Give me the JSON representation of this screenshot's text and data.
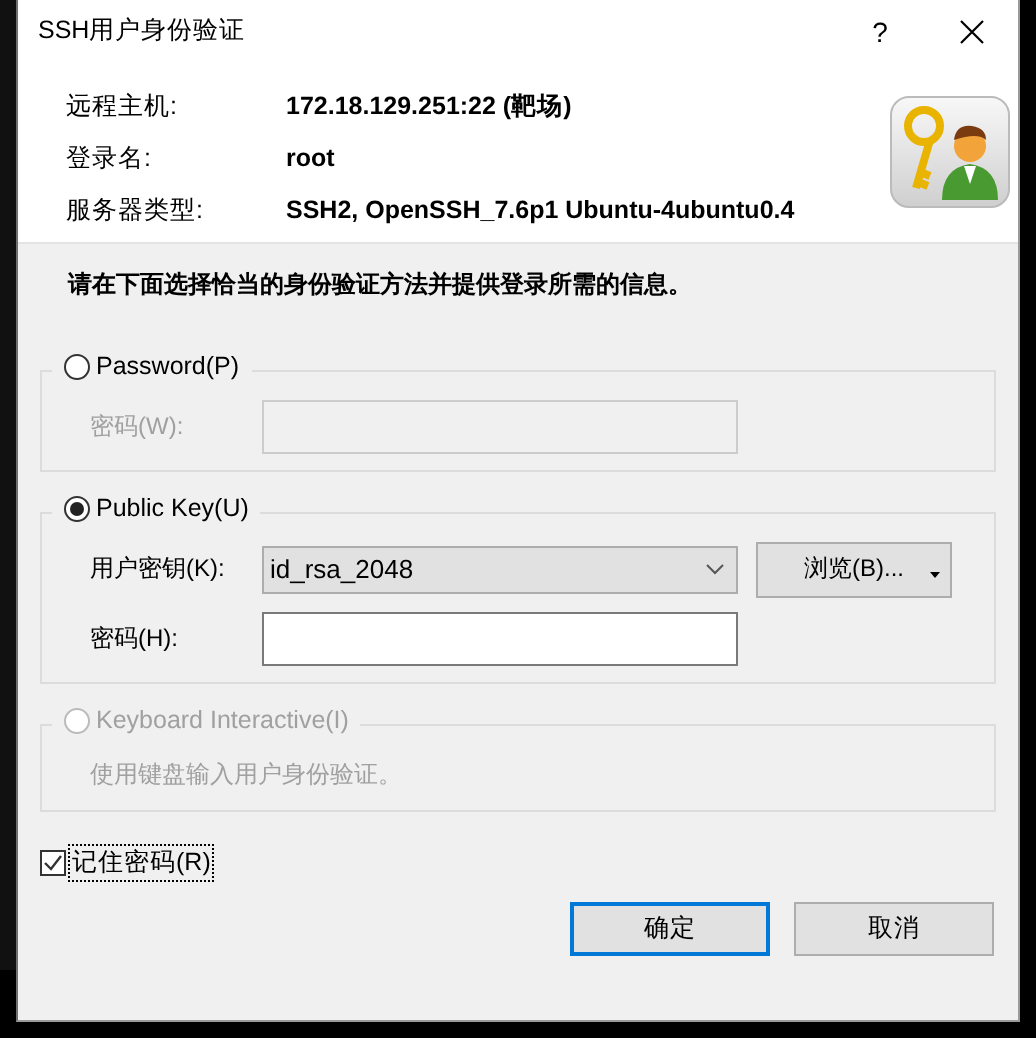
{
  "window": {
    "title": "SSH用户身份验证",
    "help": "?"
  },
  "info": [
    {
      "label": "远程主机:",
      "value": "172.18.129.251:22 (靶场)"
    },
    {
      "label": "登录名:",
      "value": "root"
    },
    {
      "label": "服务器类型:",
      "value": "SSH2, OpenSSH_7.6p1 Ubuntu-4ubuntu0.4"
    }
  ],
  "instruction": "请在下面选择恰当的身份验证方法并提供登录所需的信息。",
  "methods": [
    {
      "label": "Password(P)",
      "selected": false,
      "disabled": false,
      "rows": [
        {
          "kind": "text",
          "label": "密码(W):",
          "disabled": true
        }
      ]
    },
    {
      "label": "Public Key(U)",
      "selected": true,
      "disabled": false,
      "rows": [
        {
          "kind": "dropdown",
          "label": "用户密钥(K):",
          "value": "id_rsa_2048",
          "button": "浏览(B)...",
          "disabled": false
        },
        {
          "kind": "text",
          "label": "密码(H):",
          "disabled": false
        }
      ]
    },
    {
      "label": "Keyboard Interactive(I)",
      "selected": false,
      "disabled": true,
      "note": "使用键盘输入用户身份验证。"
    }
  ],
  "remember": {
    "label": "记住密码(R)",
    "checked": true
  },
  "buttons": [
    {
      "label": "确定",
      "default": true
    },
    {
      "label": "取消",
      "default": false
    }
  ]
}
